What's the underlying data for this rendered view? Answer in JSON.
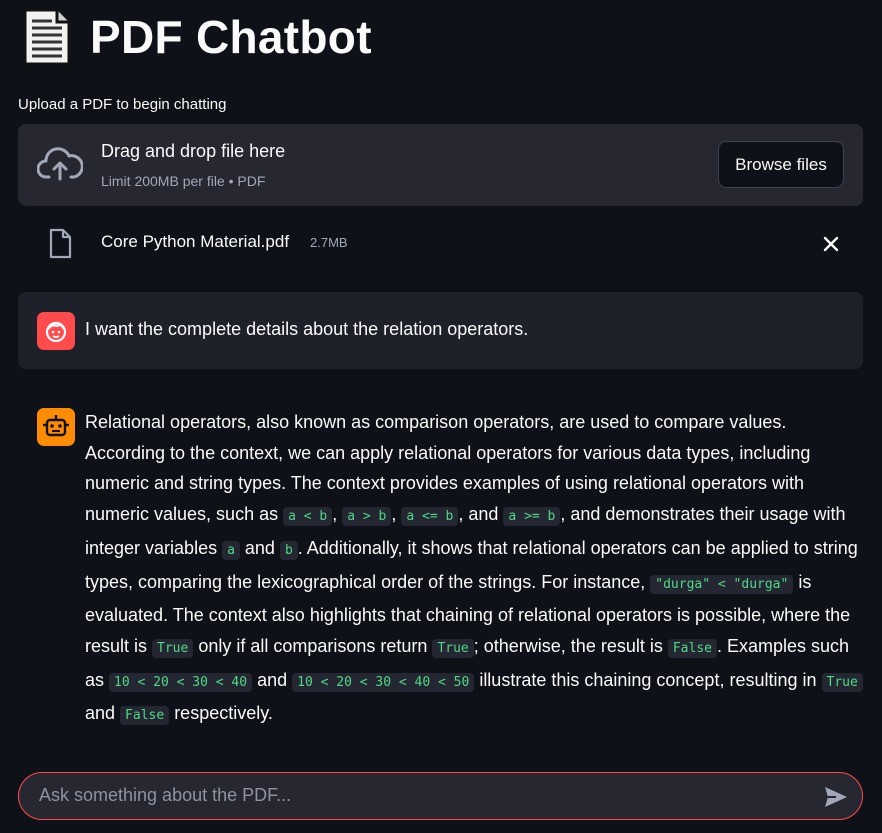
{
  "header": {
    "icon": "document-icon",
    "title": "PDF Chatbot"
  },
  "uploader": {
    "label": "Upload a PDF to begin chatting",
    "drop_title": "Drag and drop file here",
    "drop_limit": "Limit 200MB per file • PDF",
    "browse_label": "Browse files",
    "file": {
      "name": "Core Python Material.pdf",
      "size": "2.7MB"
    }
  },
  "chat": {
    "user_message": "I want the complete details about the relation operators.",
    "assistant_segments": [
      {
        "t": "Relational operators, also known as comparison operators, are used to compare values. According to the context, we can apply relational operators for various data types, including numeric and string types. The context provides examples of using relational operators with numeric values, such as "
      },
      {
        "c": "a < b"
      },
      {
        "t": ", "
      },
      {
        "c": "a > b"
      },
      {
        "t": ", "
      },
      {
        "c": "a <= b"
      },
      {
        "t": ", and "
      },
      {
        "c": "a >= b"
      },
      {
        "t": ", and demonstrates their usage with integer variables "
      },
      {
        "c": "a"
      },
      {
        "t": " and "
      },
      {
        "c": "b"
      },
      {
        "t": ". Additionally, it shows that relational operators can be applied to string types, comparing the lexicographical order of the strings. For instance, "
      },
      {
        "c": "\"durga\" < \"durga\""
      },
      {
        "t": " is evaluated. The context also highlights that chaining of relational operators is possible, where the result is "
      },
      {
        "c": "True"
      },
      {
        "t": " only if all comparisons return "
      },
      {
        "c": "True"
      },
      {
        "t": "; otherwise, the result is "
      },
      {
        "c": "False"
      },
      {
        "t": ". Examples such as "
      },
      {
        "c": "10 < 20 < 30 < 40"
      },
      {
        "t": " and "
      },
      {
        "c": "10 < 20 < 30 < 40 < 50"
      },
      {
        "t": " illustrate this chaining concept, resulting in "
      },
      {
        "c": "True"
      },
      {
        "t": " and "
      },
      {
        "c": "False"
      },
      {
        "t": " respectively."
      }
    ],
    "input_placeholder": "Ask something about the PDF..."
  },
  "colors": {
    "background": "#0e1117",
    "accent": "#ff4b4b",
    "code": "#4dd987",
    "bot_avatar": "#ff8c00"
  }
}
